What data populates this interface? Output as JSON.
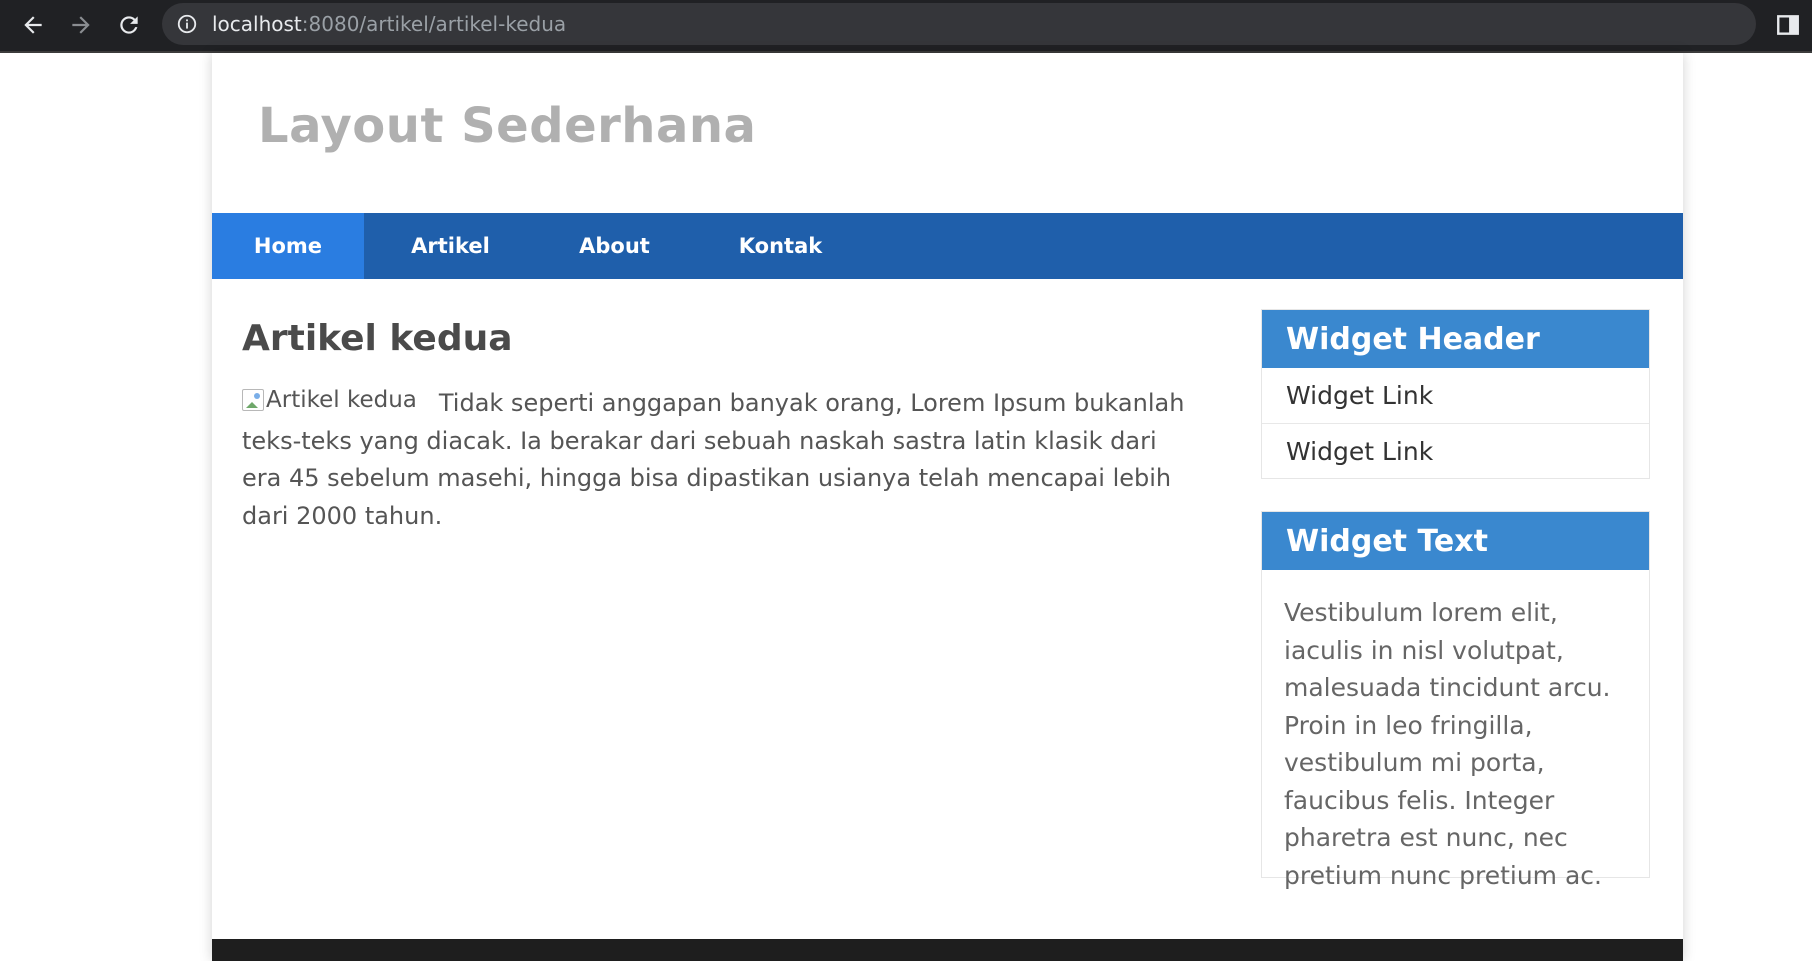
{
  "browser": {
    "url_host": "localhost",
    "url_rest": ":8080/artikel/artikel-kedua"
  },
  "site": {
    "title": "Layout Sederhana"
  },
  "nav": {
    "items": [
      "Home",
      "Artikel",
      "About",
      "Kontak"
    ],
    "active": "Home"
  },
  "article": {
    "title": "Artikel kedua",
    "image_alt": "Artikel kedua",
    "body": "Tidak seperti anggapan banyak orang, Lorem Ipsum bukanlah teks-teks yang diacak. Ia berakar dari sebuah naskah sastra latin klasik dari era 45 sebelum masehi, hingga bisa dipastikan usianya telah mencapai lebih dari 2000 tahun."
  },
  "sidebar": {
    "widget_header": {
      "title": "Widget Header",
      "links": [
        "Widget Link",
        "Widget Link"
      ]
    },
    "widget_text": {
      "title": "Widget Text",
      "text": "Vestibulum lorem elit, iaculis in nisl volutpat, malesuada tincidunt arcu. Proin in leo fringilla, vestibulum mi porta, faucibus felis. Integer pharetra est nunc, nec pretium nunc pretium ac."
    }
  },
  "colors": {
    "nav_bg": "#1f5fab",
    "nav_active": "#2a7de1",
    "widget_title_bg": "#3a88cf",
    "site_title": "#b0b0b0"
  },
  "icons": {
    "back": "arrow-left-icon",
    "forward": "arrow-right-icon",
    "reload": "reload-icon",
    "info": "info-icon",
    "share": "share-icon",
    "bookmark": "star-icon",
    "side_panel": "side-panel-icon"
  }
}
